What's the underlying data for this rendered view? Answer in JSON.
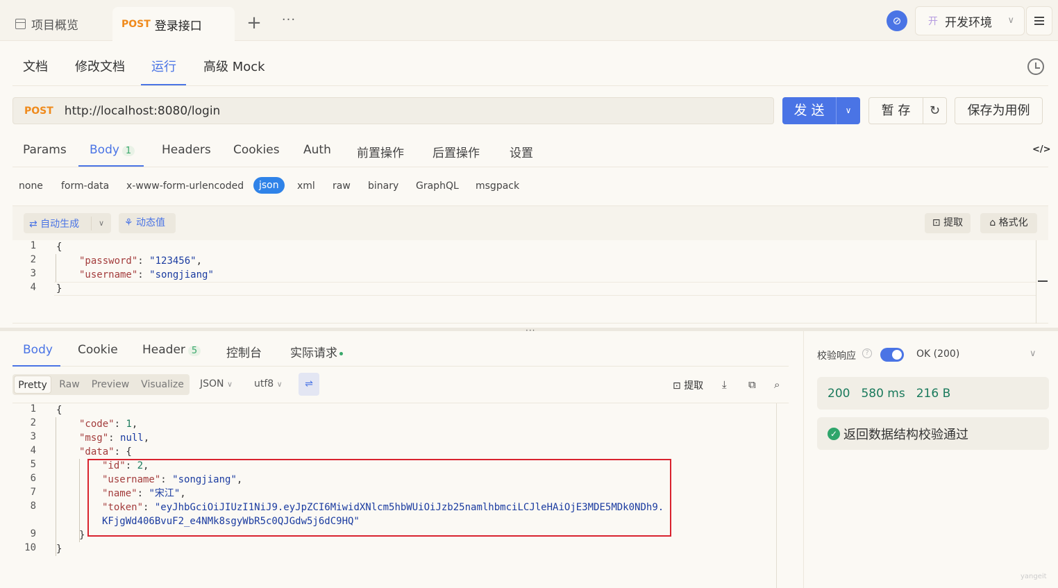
{
  "topbar": {
    "overview_label": "项目概览",
    "active_tab_method": "POST",
    "active_tab_name": "登录接口",
    "add_tab": "+",
    "more": "···",
    "env_prefix": "开",
    "env_name": "开发环境"
  },
  "subtabs": [
    "文档",
    "修改文档",
    "运行",
    "高级 Mock"
  ],
  "request": {
    "method": "POST",
    "url": "http://localhost:8080/login",
    "send_label": "发 送",
    "temp_save_label": "暂 存",
    "save_case_label": "保存为用例"
  },
  "request_tabs": {
    "params": "Params",
    "body": "Body",
    "body_count": "1",
    "headers": "Headers",
    "cookies": "Cookies",
    "auth": "Auth",
    "pre": "前置操作",
    "post": "后置操作",
    "settings": "设置",
    "code_toggle": "</>"
  },
  "body_types": [
    "none",
    "form-data",
    "x-www-form-urlencoded",
    "json",
    "xml",
    "raw",
    "binary",
    "GraphQL",
    "msgpack"
  ],
  "editor_toolbar": {
    "auto_gen": "⇄ 自动生成",
    "dynamic_value": "⚘ 动态值",
    "extract": "提取",
    "format": "格式化"
  },
  "request_body": {
    "line_numbers": [
      "1",
      "2",
      "3",
      "4"
    ],
    "open": "{",
    "password_key": "\"password\"",
    "password_value": "\"123456\"",
    "username_key": "\"username\"",
    "username_value": "\"songjiang\"",
    "close": "}"
  },
  "response_tabs": {
    "body": "Body",
    "cookie": "Cookie",
    "header": "Header",
    "header_count": "5",
    "console": "控制台",
    "actual": "实际请求"
  },
  "response_view": {
    "pretty": "Pretty",
    "raw": "Raw",
    "preview": "Preview",
    "visualize": "Visualize",
    "format": "JSON",
    "encoding": "utf8",
    "extract": "提取"
  },
  "response_body": {
    "line_numbers": [
      "1",
      "2",
      "3",
      "4",
      "5",
      "6",
      "7",
      "8",
      "9",
      "10"
    ],
    "code_key": "\"code\"",
    "code_value": "1",
    "msg_key": "\"msg\"",
    "msg_value": "null",
    "data_key": "\"data\"",
    "id_key": "\"id\"",
    "id_value": "2",
    "username_key": "\"username\"",
    "username_value": "\"songjiang\"",
    "name_key": "\"name\"",
    "name_value": "\"宋江\"",
    "token_key": "\"token\"",
    "token_value_1": "\"eyJhbGciOiJIUzI1NiJ9.eyJpZCI6MiwidXNlcm5hbWUiOiJzb25namlhbmciLCJleHAiOjE3MDE5MDk0NDh9.",
    "token_value_2": "KFjgWd406BvuF2_e4NMk8sgyWbR5c0QJGdw5j6dC9HQ\""
  },
  "verify": {
    "label": "校验响应",
    "status": "OK (200)",
    "status_code": "200",
    "time": "580 ms",
    "size": "216 B",
    "result": "返回数据结构校验通过"
  },
  "watermark": "yangeit"
}
